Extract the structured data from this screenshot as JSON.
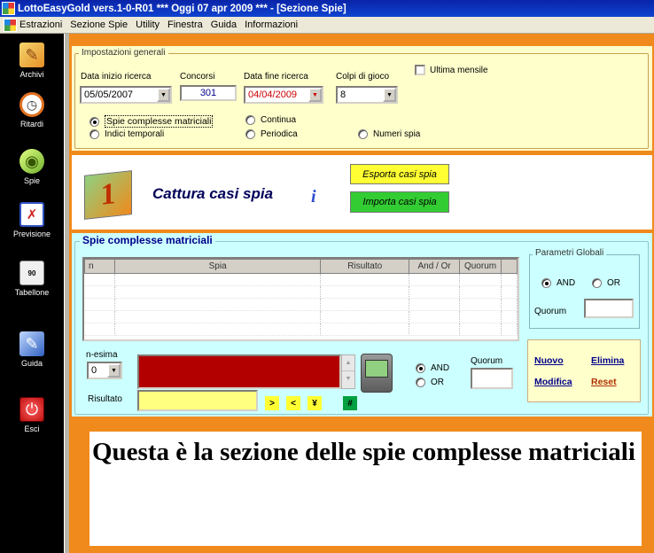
{
  "window": {
    "title": "LottoEasyGold vers.1-0-R01   ***   Oggi 07 apr 2009   ***   - [Sezione Spie]"
  },
  "menu": [
    "Estrazioni",
    "Sezione Spie",
    "Utility",
    "Finestra",
    "Guida",
    "Informazioni"
  ],
  "sidebar": {
    "items": [
      {
        "label": "Archivi",
        "icon": "pencil-icon"
      },
      {
        "label": "Ritardi",
        "icon": "clock-icon"
      },
      {
        "label": "Spie",
        "icon": "flashlight-icon"
      },
      {
        "label": "Previsione",
        "icon": "prediction-icon"
      },
      {
        "label": "Tabellone",
        "icon": "calendar-icon",
        "badge": "90"
      },
      {
        "label": "Guida",
        "icon": "book-icon"
      },
      {
        "label": "Esci",
        "icon": "power-icon"
      }
    ]
  },
  "settings": {
    "title": "Impostazioni generali",
    "start_date": {
      "label": "Data inizio ricerca",
      "value": "05/05/2007"
    },
    "concorsi": {
      "label": "Concorsi",
      "value": "301"
    },
    "end_date": {
      "label": "Data fine ricerca",
      "value": "04/04/2009"
    },
    "colpi": {
      "label": "Colpi di gioco",
      "value": "8"
    },
    "ultima_mensile": {
      "label": "Ultima mensile",
      "checked": false
    },
    "modes": {
      "spie_complesse": "Spie complesse matriciali",
      "continua": "Continua",
      "indici": "Indici temporali",
      "periodica": "Periodica",
      "numeri_spia": "Numeri spia"
    }
  },
  "capture": {
    "step_number": "1",
    "title": "Cattura casi spia",
    "export_label": "Esporta casi spia",
    "import_label": "Importa casi spia"
  },
  "matrix": {
    "title": "Spie complesse matriciali",
    "columns": [
      "n",
      "Spia",
      "Risultato",
      "And / Or",
      "Quorum"
    ],
    "global": {
      "title": "Parametri Globali",
      "and_label": "AND",
      "or_label": "OR",
      "quorum_label": "Quorum"
    },
    "nesima_label": "n-esima",
    "nesima_value": "0",
    "risultato_label": "Risultato",
    "local_and": "AND",
    "local_or": "OR",
    "local_quorum": "Quorum",
    "ops": [
      ">",
      "<",
      "¥"
    ],
    "hash": "#",
    "actions": {
      "nuovo": "Nuovo",
      "elimina": "Elimina",
      "modifica": "Modifica",
      "reset": "Reset"
    }
  },
  "info": {
    "text": "Questa è la sezione delle spie complesse matriciali"
  },
  "colors": {
    "orange": "#f08a1c",
    "yellow_panel": "#ffffcc",
    "cyan_panel": "#ccffff",
    "export": "#ffff33",
    "import": "#33cc33"
  }
}
